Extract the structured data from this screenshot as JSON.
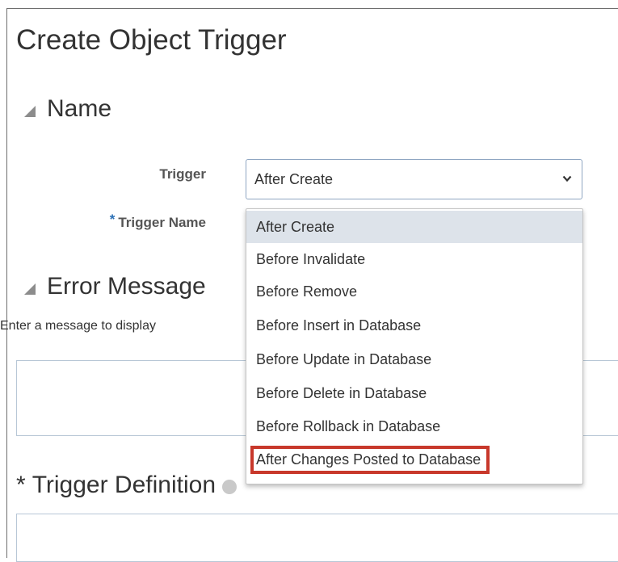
{
  "page": {
    "title": "Create Object Trigger"
  },
  "sections": {
    "name": "Name",
    "error_message": "Error Message",
    "trigger_definition": "Trigger Definition"
  },
  "fields": {
    "trigger_label": "Trigger",
    "trigger_name_label": "Trigger Name",
    "required_marker": "*",
    "trigger_value": "After Create"
  },
  "error_message": {
    "help_text": "Enter a message to display"
  },
  "dropdown": {
    "selected": "After Create",
    "highlighted": "After Changes Posted to Database",
    "options": [
      "After Create",
      "Before Invalidate",
      "Before Remove",
      "Before Insert in Database",
      "Before Update in Database",
      "Before Delete in Database",
      "Before Rollback in Database",
      "After Changes Posted to Database"
    ]
  },
  "icons": {
    "collapse": "triangle-collapse-icon",
    "info": "info-icon",
    "chevron": "chevron-down-icon"
  },
  "colors": {
    "required": "#2a6fb5",
    "highlight_border": "#c8382b",
    "selected_option_bg": "#dde3ea"
  }
}
